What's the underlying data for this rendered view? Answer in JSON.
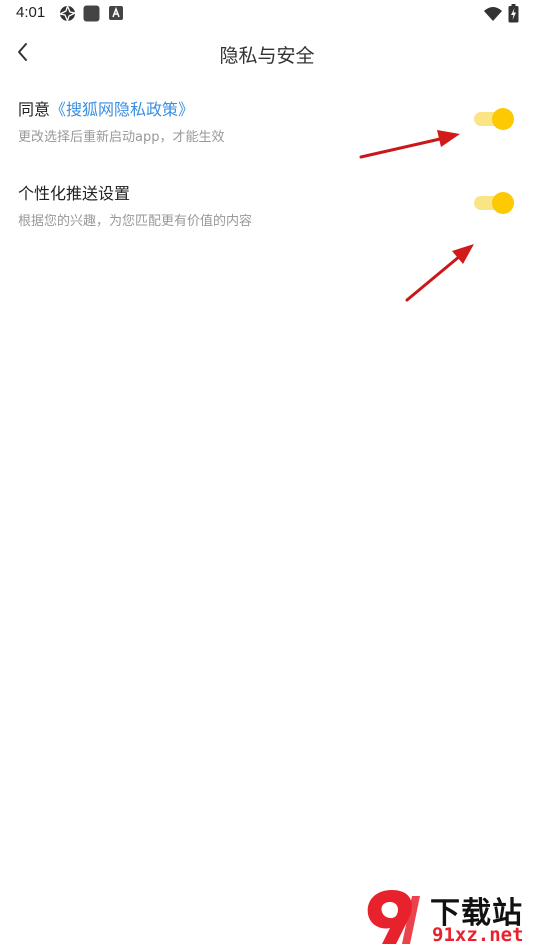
{
  "status_bar": {
    "time": "4:01"
  },
  "header": {
    "title": "隐私与安全"
  },
  "settings": [
    {
      "title_prefix": "同意",
      "title_link": "《搜狐网隐私政策》",
      "subtitle": "更改选择后重新启动app，才能生效",
      "toggle_on": true
    },
    {
      "title_prefix": "个性化推送设置",
      "title_link": "",
      "subtitle": "根据您的兴趣，为您匹配更有价值的内容",
      "toggle_on": true
    }
  ],
  "colors": {
    "accent": "#fcc903",
    "track": "#fbe486",
    "link": "#3b8fe0",
    "annotation": "#e02020"
  },
  "watermark": {
    "logo_text": "9",
    "name": "下载站",
    "site": "91xz.net"
  }
}
